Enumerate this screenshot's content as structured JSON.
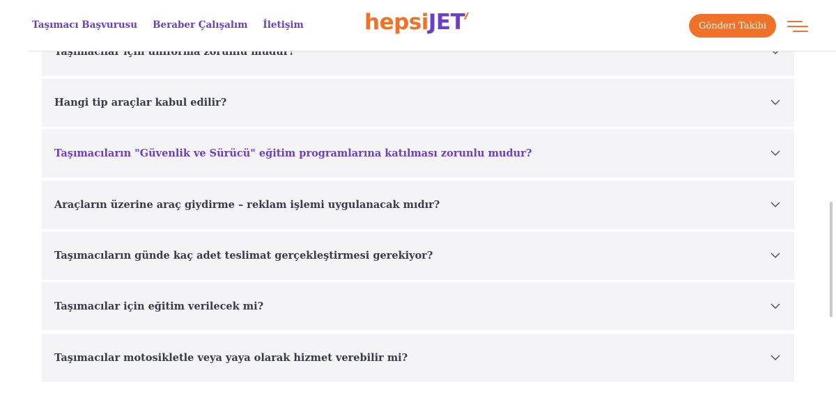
{
  "header": {
    "nav": [
      "Taşımacı Başvurusu",
      "Beraber Çalışalım",
      "İletişim"
    ],
    "logo_part1": "hepsi",
    "logo_part2": "JET",
    "track_button": "Gönderi Takibi"
  },
  "faq": {
    "items": [
      {
        "question": "Taşımacılar için üniforma zorunlu mudur?",
        "active": false
      },
      {
        "question": "Hangi tip araçlar kabul edilir?",
        "active": false
      },
      {
        "question": "Taşımacıların \"Güvenlik ve Sürücü\" eğitim programlarına katılması zorunlu mudur?",
        "active": true
      },
      {
        "question": "Araçların üzerine araç giydirme – reklam işlemi uygulanacak mıdır?",
        "active": false
      },
      {
        "question": "Taşımacıların günde kaç adet teslimat gerçekleştirmesi gerekiyor?",
        "active": false
      },
      {
        "question": "Taşımacılar için eğitim verilecek mi?",
        "active": false
      },
      {
        "question": "Taşımacılar motosikletle veya yaya olarak hizmet verebilir mi?",
        "active": false
      }
    ]
  },
  "colors": {
    "brand_orange": "#f07228",
    "brand_purple": "#6b3fc6",
    "faq_bg": "#f4f3f5",
    "text_dark": "#3a3a4a"
  },
  "icons": [
    "chevron-down-icon",
    "hamburger-menu-icon"
  ]
}
